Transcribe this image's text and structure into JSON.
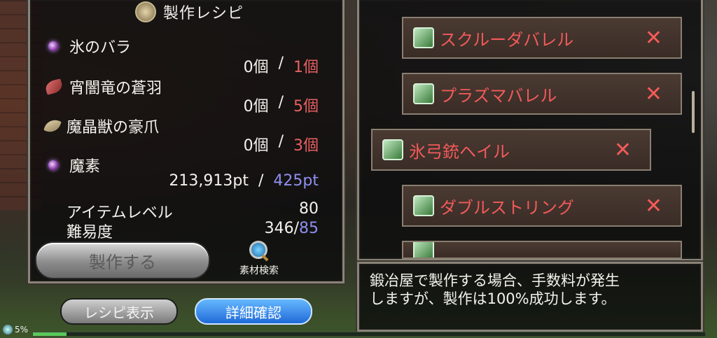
{
  "title": "製作レシピ",
  "materials": [
    {
      "name": "氷のバラ",
      "icon": "ice-rose-orb-icon",
      "have": "0個",
      "sep": "/",
      "need": "1個"
    },
    {
      "name": "宵闇竜の蒼羽",
      "icon": "feather-icon",
      "have": "0個",
      "sep": "/",
      "need": "5個"
    },
    {
      "name": "魔晶獣の豪爪",
      "icon": "claw-icon",
      "have": "0個",
      "sep": "/",
      "need": "3個"
    },
    {
      "name": "魔素",
      "icon": "mana-orb-icon",
      "have": "213,913pt",
      "sep": "/",
      "need": "425pt"
    }
  ],
  "stats": {
    "item_level_label": "アイテムレベル",
    "item_level_value": "80",
    "difficulty_label": "難易度",
    "difficulty_current": "346/",
    "difficulty_required": "85"
  },
  "buttons": {
    "craft": "製作する",
    "material_search": "素材検索",
    "recipe_display": "レシピ表示",
    "detail_confirm": "詳細確認"
  },
  "recipes": [
    {
      "name": "スクルーダバレル",
      "remove": "✕"
    },
    {
      "name": "プラズマバレル",
      "remove": "✕"
    },
    {
      "name": "氷弓銃ヘイル",
      "remove": "✕"
    },
    {
      "name": "ダブルストリング",
      "remove": "✕"
    }
  ],
  "message": {
    "line1": "鍛冶屋で製作する場合、手数料が発生",
    "line2": "しますが、製作は100%成功します。"
  },
  "status": {
    "percent_label": "5%",
    "progress": 0.05
  },
  "colors": {
    "need_red": "#e86060",
    "need_blue": "#8f8ff0",
    "recipe_text": "#f25a5a"
  }
}
